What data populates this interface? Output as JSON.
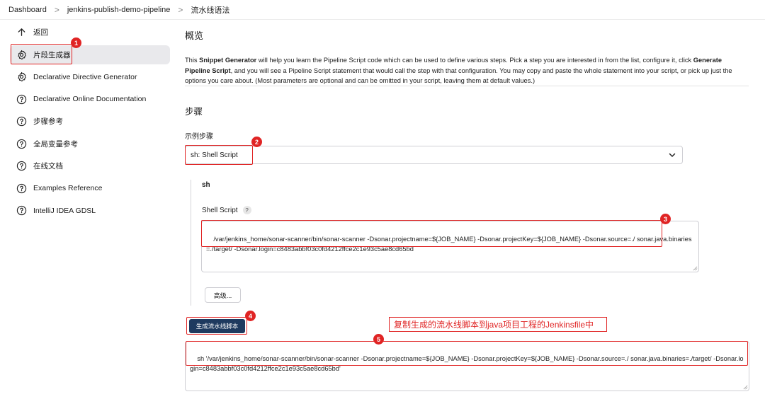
{
  "breadcrumb": {
    "items": [
      "Dashboard",
      "jenkins-publish-demo-pipeline",
      "流水线语法"
    ],
    "separator": ">"
  },
  "sidebar": {
    "items": [
      {
        "label": "返回",
        "icon": "arrow-up-icon"
      },
      {
        "label": "片段生成器",
        "icon": "gear-icon",
        "active": true
      },
      {
        "label": "Declarative Directive Generator",
        "icon": "gear-icon"
      },
      {
        "label": "Declarative Online Documentation",
        "icon": "help-circle-icon"
      },
      {
        "label": "步骤参考",
        "icon": "help-circle-icon"
      },
      {
        "label": "全局变量参考",
        "icon": "help-circle-icon"
      },
      {
        "label": "在线文档",
        "icon": "help-circle-icon"
      },
      {
        "label": "Examples Reference",
        "icon": "help-circle-icon"
      },
      {
        "label": "IntelliJ IDEA GDSL",
        "icon": "help-circle-icon"
      }
    ]
  },
  "main": {
    "overview_title": "概览",
    "intro": {
      "p1": "This ",
      "b1": "Snippet Generator",
      "p2": " will help you learn the Pipeline Script code which can be used to define various steps. Pick a step you are interested in from the list, configure it, click ",
      "b2": "Generate Pipeline Script",
      "p3": ", and you will see a Pipeline Script statement that would call the step with that configuration. You may copy and paste the whole statement into your script, or pick up just the options you care about. (Most parameters are optional and can be omitted in your script, leaving them at default values.)"
    },
    "steps_title": "步骤",
    "sample_step_label": "示例步骤",
    "sample_step_value": "sh: Shell Script",
    "sh_title": "sh",
    "shell_script_label": "Shell Script",
    "shell_script_help": "?",
    "shell_script_value": "/var/jenkins_home/sonar-scanner/bin/sonar-scanner -Dsonar.projectname=${JOB_NAME} -Dsonar.projectKey=${JOB_NAME} -Dsonar.source=./ sonar.java.binaries=./target/ -Dsonar.login=c8483abbf03c0fd4212ffce2c1e93c5ae8cd65bd",
    "advanced_button": "高级...",
    "generate_button": "生成流水线脚本",
    "generated_script": "sh '/var/jenkins_home/sonar-scanner/bin/sonar-scanner -Dsonar.projectname=${JOB_NAME} -Dsonar.projectKey=${JOB_NAME} -Dsonar.source=./ sonar.java.binaries=./target/ -Dsonar.login=c8483abbf03c0fd4212ffce2c1e93c5ae8cd65bd'"
  },
  "annotations": {
    "badges": [
      "1",
      "2",
      "3",
      "4",
      "5"
    ],
    "callout": "复制生成的流水线脚本到java项目工程的Jenkinsfile中",
    "color": "#e02424"
  },
  "colors": {
    "active_bg": "#e9e9ec",
    "primary_button": "#1e3a5f"
  }
}
